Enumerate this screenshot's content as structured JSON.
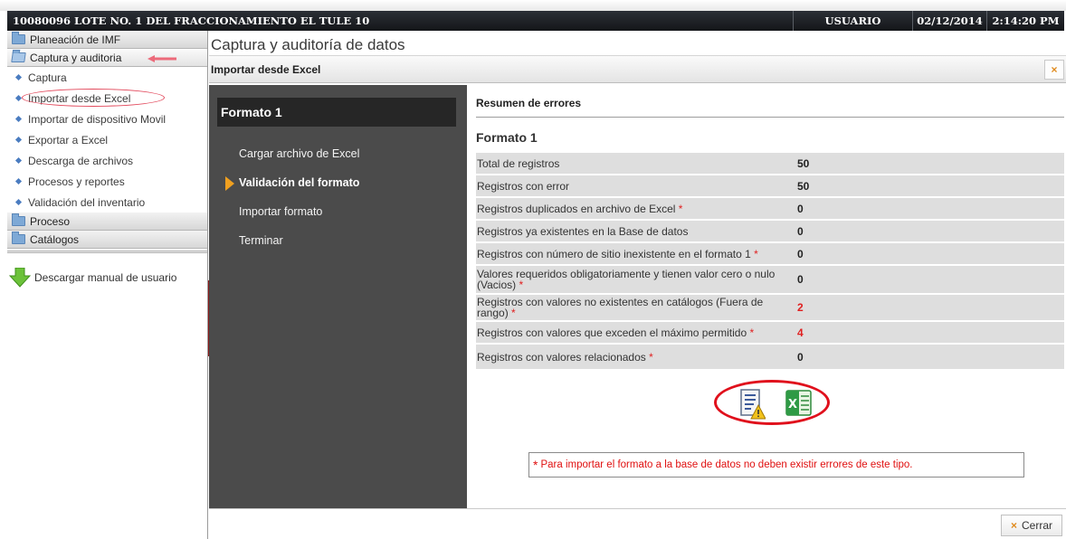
{
  "titlebar": {
    "title": "10080096 LOTE NO. 1 DEL FRACCIONAMIENTO EL TULE 10",
    "user": "USUARIO",
    "date": "02/12/2014",
    "time": "2:14:20 PM"
  },
  "sidebar": {
    "sections": [
      {
        "label": "Planeación de IMF"
      },
      {
        "label": "Captura y auditoria"
      },
      {
        "label": "Proceso"
      },
      {
        "label": "Catálogos"
      }
    ],
    "items": [
      {
        "label": "Captura"
      },
      {
        "label": "Importar desde Excel"
      },
      {
        "label": "Importar de dispositivo Movil"
      },
      {
        "label": "Exportar a Excel"
      },
      {
        "label": "Descarga de archivos"
      },
      {
        "label": "Procesos y reportes"
      },
      {
        "label": "Validación del inventario"
      }
    ],
    "manual_link": "Descargar manual de usuario"
  },
  "main": {
    "title": "Captura y auditoría de datos",
    "subtitle": "Importar desde Excel",
    "close_label": "×"
  },
  "wizard": {
    "header": "Formato 1",
    "steps": [
      {
        "label": "Cargar archivo de Excel"
      },
      {
        "label": "Validación del formato"
      },
      {
        "label": "Importar formato"
      },
      {
        "label": "Terminar"
      }
    ],
    "active_step": 1
  },
  "summary": {
    "title": "Resumen de errores",
    "format_title": "Formato 1",
    "rows": [
      {
        "label": "Total de registros",
        "required_mark": "",
        "value": "50"
      },
      {
        "label": "Registros con error",
        "required_mark": "",
        "value": "50"
      },
      {
        "label": "Registros duplicados en archivo de Excel",
        "required_mark": "*",
        "value": "0"
      },
      {
        "label": "Registros ya existentes en la Base de datos",
        "required_mark": "",
        "value": "0"
      },
      {
        "label": "Registros con número de sitio inexistente en el formato 1",
        "required_mark": "*",
        "value": "0"
      },
      {
        "label": "Valores requeridos obligatoriamente y tienen valor cero o nulo (Vacios)",
        "required_mark": "*",
        "value": "0"
      },
      {
        "label": "Registros con valores no existentes en catálogos (Fuera de rango)",
        "required_mark": "*",
        "value": "2"
      },
      {
        "label": "Registros con valores que exceden el máximo permitido",
        "required_mark": "*",
        "value": "4"
      },
      {
        "label": "Registros con valores relacionados",
        "required_mark": "*",
        "value": "0"
      }
    ],
    "note_mark": "*",
    "note": "Para importar el formato a la base de datos no deben existir errores de este tipo."
  },
  "footer": {
    "close_button": "Cerrar",
    "close_icon": "×"
  },
  "colors": {
    "error_red": "#e02020",
    "accent_orange": "#f0a020",
    "wizard_bg": "#4b4b4b",
    "titlebar_bg": "#1e2126"
  }
}
